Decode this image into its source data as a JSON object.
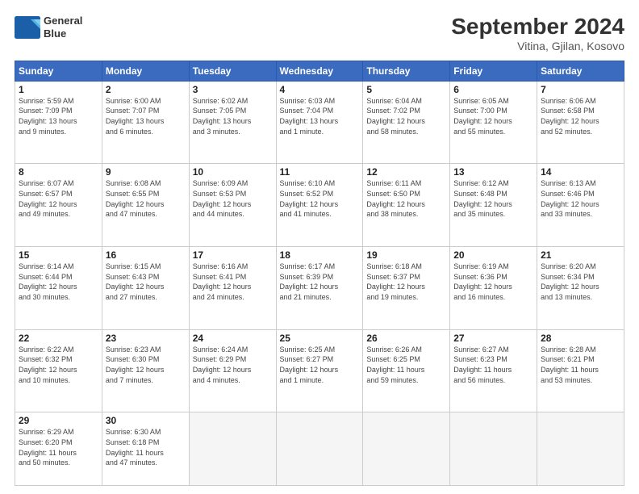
{
  "logo": {
    "line1": "General",
    "line2": "Blue"
  },
  "title": "September 2024",
  "subtitle": "Vitina, Gjilan, Kosovo",
  "days_header": [
    "Sunday",
    "Monday",
    "Tuesday",
    "Wednesday",
    "Thursday",
    "Friday",
    "Saturday"
  ],
  "weeks": [
    [
      {
        "num": "1",
        "info": "Sunrise: 5:59 AM\nSunset: 7:09 PM\nDaylight: 13 hours\nand 9 minutes."
      },
      {
        "num": "2",
        "info": "Sunrise: 6:00 AM\nSunset: 7:07 PM\nDaylight: 13 hours\nand 6 minutes."
      },
      {
        "num": "3",
        "info": "Sunrise: 6:02 AM\nSunset: 7:05 PM\nDaylight: 13 hours\nand 3 minutes."
      },
      {
        "num": "4",
        "info": "Sunrise: 6:03 AM\nSunset: 7:04 PM\nDaylight: 13 hours\nand 1 minute."
      },
      {
        "num": "5",
        "info": "Sunrise: 6:04 AM\nSunset: 7:02 PM\nDaylight: 12 hours\nand 58 minutes."
      },
      {
        "num": "6",
        "info": "Sunrise: 6:05 AM\nSunset: 7:00 PM\nDaylight: 12 hours\nand 55 minutes."
      },
      {
        "num": "7",
        "info": "Sunrise: 6:06 AM\nSunset: 6:58 PM\nDaylight: 12 hours\nand 52 minutes."
      }
    ],
    [
      {
        "num": "8",
        "info": "Sunrise: 6:07 AM\nSunset: 6:57 PM\nDaylight: 12 hours\nand 49 minutes."
      },
      {
        "num": "9",
        "info": "Sunrise: 6:08 AM\nSunset: 6:55 PM\nDaylight: 12 hours\nand 47 minutes."
      },
      {
        "num": "10",
        "info": "Sunrise: 6:09 AM\nSunset: 6:53 PM\nDaylight: 12 hours\nand 44 minutes."
      },
      {
        "num": "11",
        "info": "Sunrise: 6:10 AM\nSunset: 6:52 PM\nDaylight: 12 hours\nand 41 minutes."
      },
      {
        "num": "12",
        "info": "Sunrise: 6:11 AM\nSunset: 6:50 PM\nDaylight: 12 hours\nand 38 minutes."
      },
      {
        "num": "13",
        "info": "Sunrise: 6:12 AM\nSunset: 6:48 PM\nDaylight: 12 hours\nand 35 minutes."
      },
      {
        "num": "14",
        "info": "Sunrise: 6:13 AM\nSunset: 6:46 PM\nDaylight: 12 hours\nand 33 minutes."
      }
    ],
    [
      {
        "num": "15",
        "info": "Sunrise: 6:14 AM\nSunset: 6:44 PM\nDaylight: 12 hours\nand 30 minutes."
      },
      {
        "num": "16",
        "info": "Sunrise: 6:15 AM\nSunset: 6:43 PM\nDaylight: 12 hours\nand 27 minutes."
      },
      {
        "num": "17",
        "info": "Sunrise: 6:16 AM\nSunset: 6:41 PM\nDaylight: 12 hours\nand 24 minutes."
      },
      {
        "num": "18",
        "info": "Sunrise: 6:17 AM\nSunset: 6:39 PM\nDaylight: 12 hours\nand 21 minutes."
      },
      {
        "num": "19",
        "info": "Sunrise: 6:18 AM\nSunset: 6:37 PM\nDaylight: 12 hours\nand 19 minutes."
      },
      {
        "num": "20",
        "info": "Sunrise: 6:19 AM\nSunset: 6:36 PM\nDaylight: 12 hours\nand 16 minutes."
      },
      {
        "num": "21",
        "info": "Sunrise: 6:20 AM\nSunset: 6:34 PM\nDaylight: 12 hours\nand 13 minutes."
      }
    ],
    [
      {
        "num": "22",
        "info": "Sunrise: 6:22 AM\nSunset: 6:32 PM\nDaylight: 12 hours\nand 10 minutes."
      },
      {
        "num": "23",
        "info": "Sunrise: 6:23 AM\nSunset: 6:30 PM\nDaylight: 12 hours\nand 7 minutes."
      },
      {
        "num": "24",
        "info": "Sunrise: 6:24 AM\nSunset: 6:29 PM\nDaylight: 12 hours\nand 4 minutes."
      },
      {
        "num": "25",
        "info": "Sunrise: 6:25 AM\nSunset: 6:27 PM\nDaylight: 12 hours\nand 1 minute."
      },
      {
        "num": "26",
        "info": "Sunrise: 6:26 AM\nSunset: 6:25 PM\nDaylight: 11 hours\nand 59 minutes."
      },
      {
        "num": "27",
        "info": "Sunrise: 6:27 AM\nSunset: 6:23 PM\nDaylight: 11 hours\nand 56 minutes."
      },
      {
        "num": "28",
        "info": "Sunrise: 6:28 AM\nSunset: 6:21 PM\nDaylight: 11 hours\nand 53 minutes."
      }
    ],
    [
      {
        "num": "29",
        "info": "Sunrise: 6:29 AM\nSunset: 6:20 PM\nDaylight: 11 hours\nand 50 minutes."
      },
      {
        "num": "30",
        "info": "Sunrise: 6:30 AM\nSunset: 6:18 PM\nDaylight: 11 hours\nand 47 minutes."
      },
      {
        "num": "",
        "info": ""
      },
      {
        "num": "",
        "info": ""
      },
      {
        "num": "",
        "info": ""
      },
      {
        "num": "",
        "info": ""
      },
      {
        "num": "",
        "info": ""
      }
    ]
  ]
}
